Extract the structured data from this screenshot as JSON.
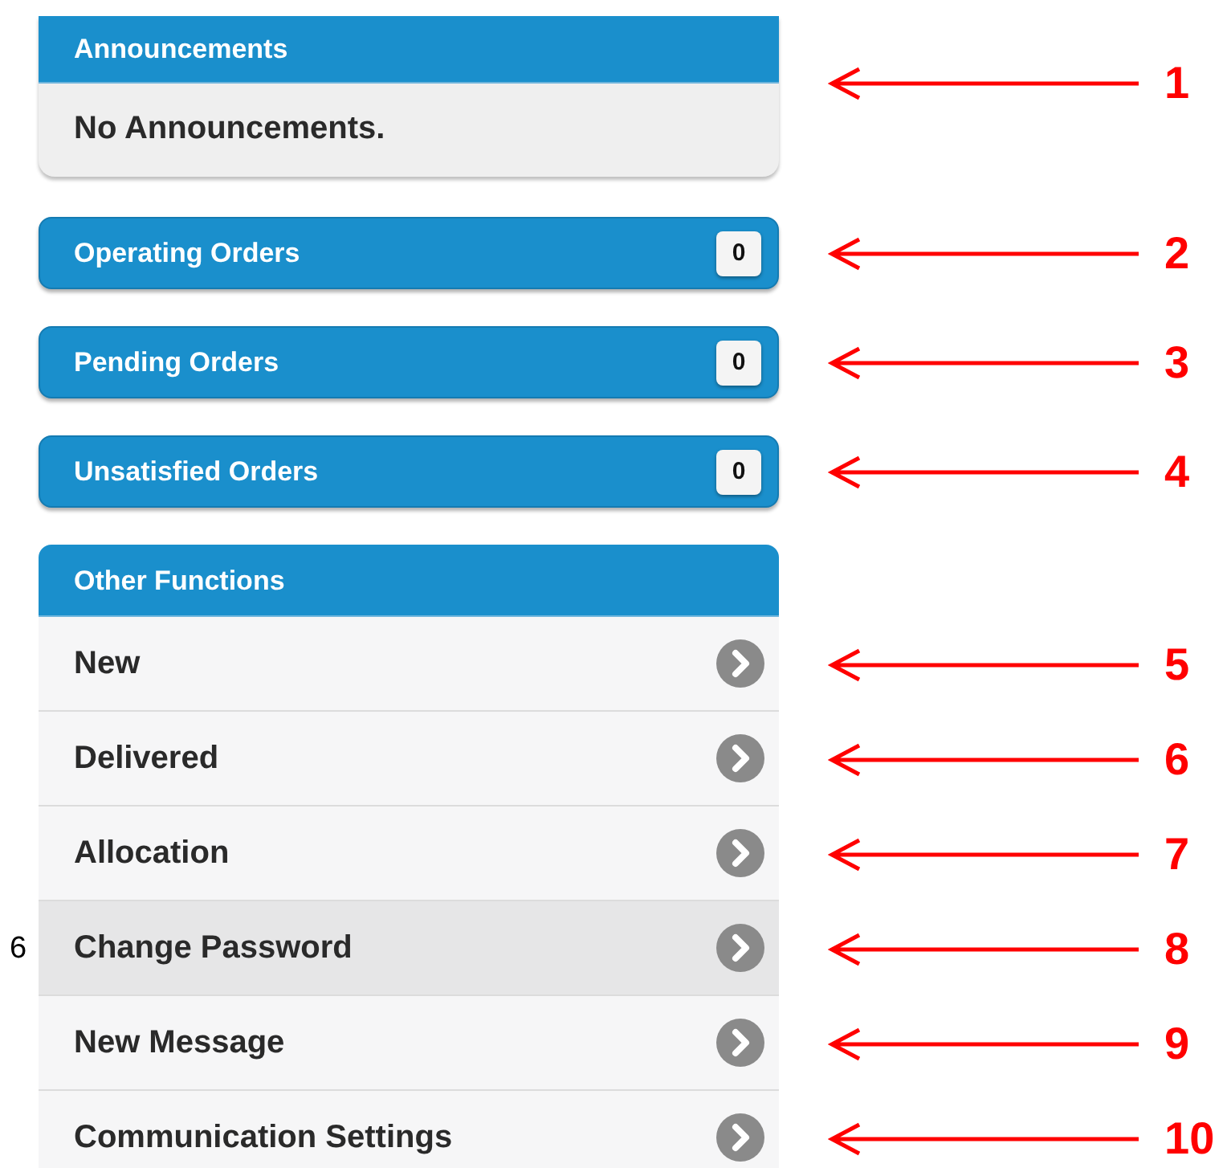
{
  "announcements": {
    "title": "Announcements",
    "message": "No Announcements.",
    "note": "1"
  },
  "order_counters": [
    {
      "label": "Operating Orders",
      "count": "0",
      "note": "2"
    },
    {
      "label": "Pending Orders",
      "count": "0",
      "note": "3"
    },
    {
      "label": "Unsatisfied Orders",
      "count": "0",
      "note": "4"
    }
  ],
  "other_functions": {
    "title": "Other Functions",
    "items": [
      {
        "label": "New",
        "selected": false,
        "note": "5"
      },
      {
        "label": "Delivered",
        "selected": false,
        "note": "6"
      },
      {
        "label": "Allocation",
        "selected": false,
        "note": "7"
      },
      {
        "label": "Change Password",
        "selected": true,
        "note": "8",
        "side_label": "6"
      },
      {
        "label": "New Message",
        "selected": false,
        "note": "9"
      },
      {
        "label": "Communication Settings",
        "selected": false,
        "note": "10"
      }
    ]
  }
}
